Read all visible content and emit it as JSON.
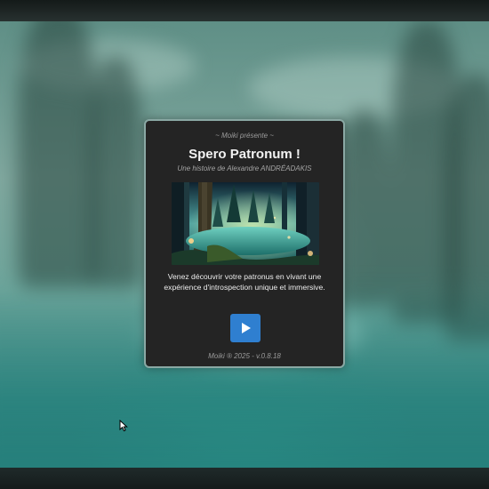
{
  "splash": {
    "presents": "~ Moiki présente ~",
    "title": "Spero Patronum !",
    "author": "Une histoire de Alexandre ANDRÉADAKIS",
    "description": "Venez découvrir votre patronus en vivant une expérience d'introspection unique et immersive.",
    "play_icon": "play-icon",
    "version": "Moiki ® 2025 - v.0.8.18"
  },
  "colors": {
    "card_background": "#242424",
    "card_border": "#8aa8a4",
    "play_button": "#2f7fd0",
    "backdrop": "#3f7d76"
  },
  "cursor_icon": "mouse-pointer-icon"
}
